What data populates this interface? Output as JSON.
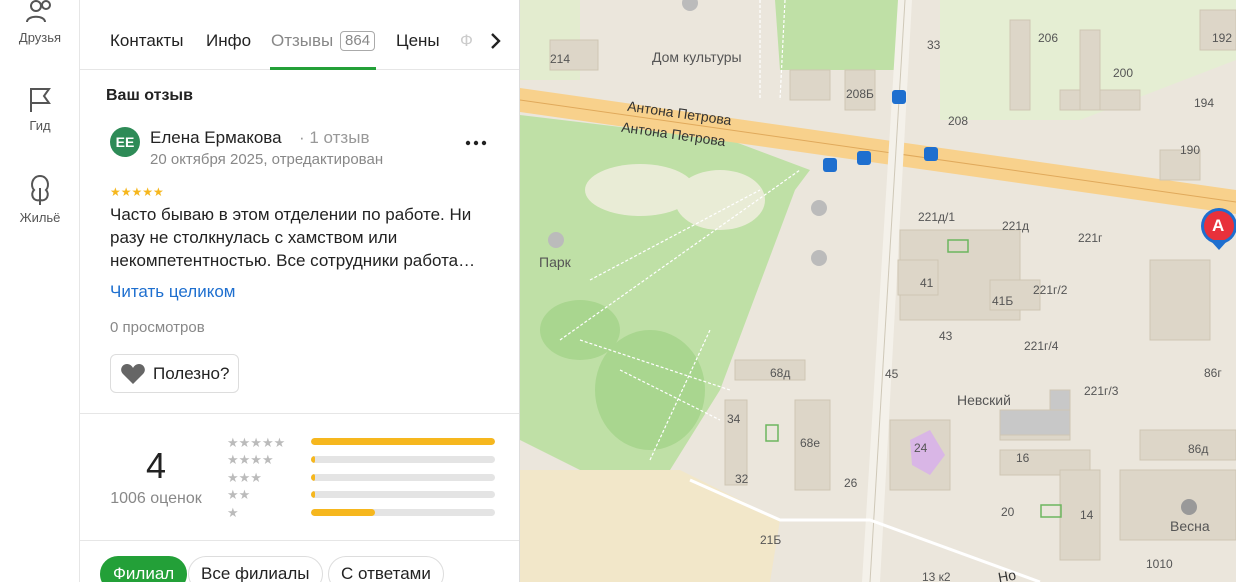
{
  "rail": {
    "friends_label": "Друзья",
    "guide_label": "Гид",
    "housing_label": "Жильё"
  },
  "tabs": {
    "contacts": "Контакты",
    "info": "Инфо",
    "reviews": "Отзывы",
    "reviews_count": "864",
    "prices": "Цены",
    "photos_cut": "Ф"
  },
  "review": {
    "section_title": "Ваш отзыв",
    "avatar_initials": "ЕЕ",
    "author": "Елена Ермакова",
    "author_reviews": "· 1 отзыв",
    "date": "20 октября 2025, отредактирован",
    "rating": 5,
    "stars": "★★★★★",
    "text": "Часто бываю в этом отделении по работе. Ни разу не столкнулась с хамством или некомпетентностью. Все сотрудники работа…",
    "read_more": "Читать целиком",
    "views": "0 просмотров",
    "useful_label": "Полезно?"
  },
  "rating_summary": {
    "value": "4",
    "count_label": "1006 оценок",
    "distribution": [
      {
        "stars": "★★★★★",
        "fraction": 1.0
      },
      {
        "stars": "★★★★",
        "fraction": 0.02
      },
      {
        "stars": "★★★",
        "fraction": 0.02
      },
      {
        "stars": "★★",
        "fraction": 0.02
      },
      {
        "stars": "★",
        "fraction": 0.35
      }
    ]
  },
  "filters": {
    "branch": "Филиал",
    "all_branches": "Все филиалы",
    "with_answers": "С ответами"
  },
  "map": {
    "labels": {
      "culture_house": "Дом культуры",
      "park": "Парк",
      "street_1": "Антона Петрова",
      "street_2": "Антона Петрова",
      "nevsky": "Невский",
      "vesna": "Весна",
      "marker": "А",
      "n214": "214",
      "n33": "33",
      "n206": "206",
      "n200": "200",
      "n192": "192",
      "n194": "194",
      "n208b": "208Б",
      "n208": "208",
      "n190": "190",
      "n221d1": "221д/1",
      "n221d": "221д",
      "n221g": "221г",
      "n41": "41",
      "n41b": "41Б",
      "n221g2": "221г/2",
      "n43": "43",
      "n221g4": "221г/4",
      "n68d": "68д",
      "n45": "45",
      "n221g3": "221г/3",
      "n86g": "86г",
      "n34": "34",
      "n68e": "68е",
      "n24": "24",
      "n86d": "86д",
      "n16": "16",
      "n32": "32",
      "n26": "26",
      "n20": "20",
      "n14": "14",
      "n21b": "21Б",
      "n13k2": "13 к2",
      "n1010": "1010",
      "no": "Но"
    },
    "colors": {
      "park_green": "#bfe0a6",
      "road": "#f8d18c",
      "block": "#ddd6c8",
      "marker": "#e8313b"
    }
  }
}
